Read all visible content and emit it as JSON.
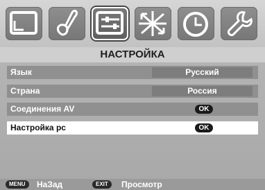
{
  "tabs": [
    {
      "icon": "picture-icon",
      "active": false
    },
    {
      "icon": "sound-icon",
      "active": false
    },
    {
      "icon": "setup-icon",
      "active": true
    },
    {
      "icon": "feature-icon",
      "active": false
    },
    {
      "icon": "clock-icon",
      "active": false
    },
    {
      "icon": "tools-icon",
      "active": false
    }
  ],
  "title": "НАСТРОЙКА",
  "menu": [
    {
      "label": "Язык",
      "value": "Русский"
    },
    {
      "label": "Страна",
      "value": "Россия"
    },
    {
      "label": "Соединения AV",
      "ok": "OK"
    },
    {
      "label": "Настройка pc",
      "ok": "OK",
      "selected": true
    }
  ],
  "footer": {
    "menu_key": "MENU",
    "menu_label": "НаЗад",
    "exit_key": "EXIT",
    "exit_label": "Просмотр"
  },
  "colors": {
    "background": "#a8a8a8",
    "row": "#909090",
    "row_selected": "#ffffff",
    "value_box": "#7d7d7d"
  }
}
